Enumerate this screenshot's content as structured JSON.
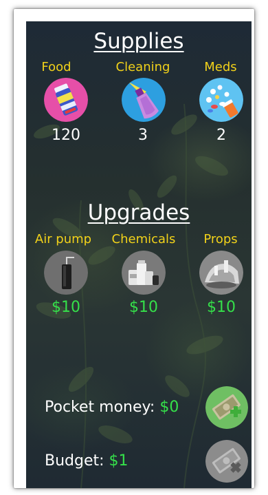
{
  "supplies": {
    "title": "Supplies",
    "items": [
      {
        "label": "Food",
        "value": "120",
        "icon": "food-container-icon"
      },
      {
        "label": "Cleaning",
        "value": "3",
        "icon": "cleaning-spray-icon"
      },
      {
        "label": "Meds",
        "value": "2",
        "icon": "medicine-pills-icon"
      }
    ]
  },
  "upgrades": {
    "title": "Upgrades",
    "items": [
      {
        "label": "Air pump",
        "price": "$10",
        "icon": "air-pump-icon"
      },
      {
        "label": "Chemicals",
        "price": "$10",
        "icon": "chemicals-bottles-icon"
      },
      {
        "label": "Props",
        "price": "$10",
        "icon": "aquarium-props-icon"
      }
    ]
  },
  "pocket_money": {
    "label": "Pocket money:",
    "amount": "$0",
    "button_icon": "add-money-icon"
  },
  "budget": {
    "label": "Budget:",
    "amount": "$1",
    "button_icon": "remove-money-icon"
  },
  "colors": {
    "label_yellow": "#f2d21a",
    "value_green": "#35e04a",
    "text_white": "#ffffff"
  }
}
